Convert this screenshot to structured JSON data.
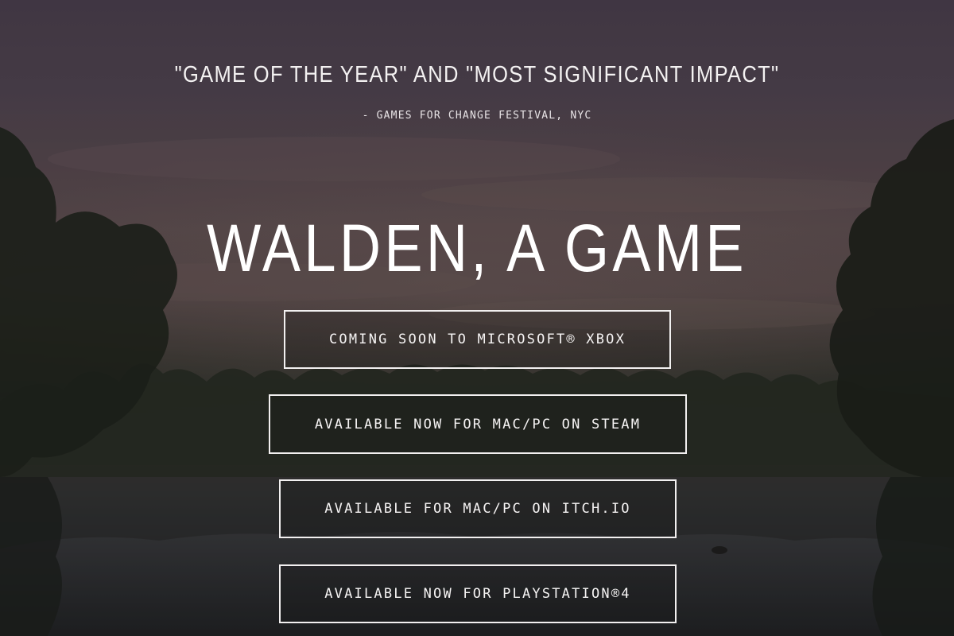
{
  "award": {
    "quote": "\"GAME OF THE YEAR\" AND \"MOST SIGNIFICANT IMPACT\"",
    "source": "- GAMES FOR CHANGE FESTIVAL, NYC"
  },
  "title": "WALDEN, A GAME",
  "platform_links": [
    {
      "label": "COMING SOON TO MICROSOFT® XBOX"
    },
    {
      "label": "AVAILABLE NOW FOR MAC/PC ON STEAM"
    },
    {
      "label": "AVAILABLE FOR MAC/PC ON ITCH.IO"
    },
    {
      "label": "AVAILABLE NOW FOR PLAYSTATION®4"
    }
  ],
  "colors": {
    "text": "#ffffff",
    "button_border": "#f2f0f0",
    "sky": "#4f4450"
  }
}
